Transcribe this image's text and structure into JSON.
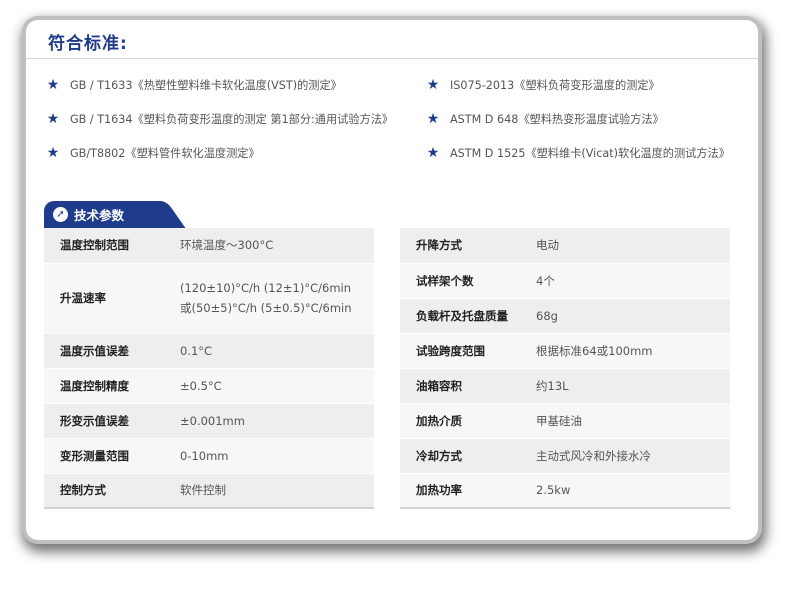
{
  "standards": {
    "title": "符合标准:",
    "left": [
      "GB / T1633《热塑性塑料维卡软化温度(VST)的测定》",
      "GB / T1634《塑料负荷变形温度的测定 第1部分:通用试验方法》",
      "GB/T8802《塑料管件软化温度测定》"
    ],
    "right": [
      "IS075-2013《塑料负荷变形温度的测定》",
      "ASTM D 648《塑料热变形温度试验方法》",
      "ASTM D 1525《塑料维卡(Vicat)软化温度的测试方法》"
    ],
    "star_icon": "star-icon",
    "accent_color": "#1f3c8c"
  },
  "specs": {
    "tab_label": "技术参数",
    "tab_icon": "arrow-icon",
    "left": [
      {
        "label": "温度控制范围",
        "value": "环境温度～300°C"
      },
      {
        "label": "升温速率",
        "value_line1": "(120±10)°C/h  (12±1)°C/6min",
        "value_line2": "或(50±5)°C/h  (5±0.5)°C/6min"
      },
      {
        "label": "温度示值误差",
        "value": "0.1°C"
      },
      {
        "label": "温度控制精度",
        "value": "±0.5°C"
      },
      {
        "label": "形变示值误差",
        "value": "±0.001mm"
      },
      {
        "label": "变形测量范围",
        "value": "0-10mm"
      },
      {
        "label": "控制方式",
        "value": "软件控制"
      }
    ],
    "right": [
      {
        "label": "升降方式",
        "value": "电动"
      },
      {
        "label": "试样架个数",
        "value": "4个"
      },
      {
        "label": "负载杆及托盘质量",
        "value": "68g"
      },
      {
        "label": "试验跨度范围",
        "value": "根据标准64或100mm"
      },
      {
        "label": "油箱容积",
        "value": "约13L"
      },
      {
        "label": "加热介质",
        "value": "甲基硅油"
      },
      {
        "label": "冷却方式",
        "value": "主动式风冷和外接水冷"
      },
      {
        "label": "加热功率",
        "value": "2.5kw"
      }
    ]
  }
}
